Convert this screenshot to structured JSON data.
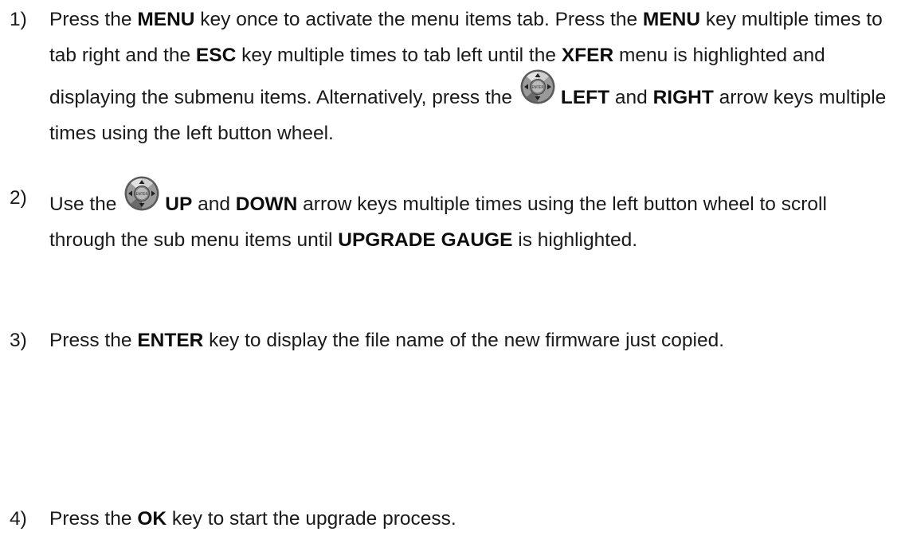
{
  "steps": [
    {
      "number": "1)",
      "t1": "Press the ",
      "b1": "MENU",
      "t2": " key once to activate the menu items tab.  Press the ",
      "b2": "MENU",
      "t3": " key multiple times to tab right and the ",
      "b3": "ESC",
      "t4": " key multiple times to tab left until the ",
      "b4": "XFER",
      "t5": " menu is highlighted and displaying the submenu items. Alternatively, press the ",
      "b5": "LEFT",
      "t6": " and ",
      "b6": "RIGHT",
      "t7": " arrow keys multiple times using the left button wheel."
    },
    {
      "number": "2)",
      "t1": "Use the ",
      "b1": "UP",
      "t2": " and ",
      "b2": "DOWN",
      "t3": " arrow keys multiple times using the left button wheel to scroll through the sub menu items until ",
      "b3": "UPGRADE GAUGE",
      "t4": " is highlighted."
    },
    {
      "number": "3)",
      "t1": "Press the ",
      "b1": "ENTER",
      "t2": " key to display the file name of the new firmware just copied."
    },
    {
      "number": "4)",
      "t1": "Press the ",
      "b1": "OK",
      "t2": " key to start the upgrade process."
    }
  ],
  "icons": {
    "button_wheel": "dpad-enter-icon",
    "center_label": "ENTER"
  }
}
